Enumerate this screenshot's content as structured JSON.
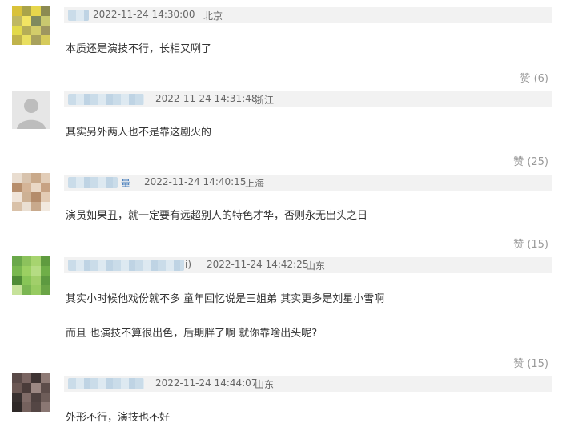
{
  "comments": [
    {
      "time": "2022-11-24 14:30:00",
      "location": "北京",
      "lines": [
        "本质还是演技不行，长相又咧了"
      ],
      "like_label": "赞",
      "like_count": "(6)",
      "name_tail": "",
      "avatar_colors": [
        "#d9c23a",
        "#a9a34a",
        "#e6d64c",
        "#8c8a52",
        "#bfb861",
        "#f2e463",
        "#7f8a5e",
        "#c9c86f",
        "#e2d94a",
        "#b5ad57",
        "#d3cd6a",
        "#9e9660",
        "#c0b34b",
        "#e9df60",
        "#a8a15c",
        "#d6cb5b"
      ]
    },
    {
      "time": "2022-11-24 14:31:48",
      "location": "浙江",
      "lines": [
        "其实另外两人也不是靠这剧火的"
      ],
      "like_label": "赞",
      "like_count": "(25)",
      "name_tail": "",
      "avatar_colors": []
    },
    {
      "time": "2022-11-24 14:40:15",
      "location": "上海",
      "lines": [
        "演员如果丑，就一定要有远超别人的特色才华，否则永无出头之日"
      ],
      "like_label": "赞",
      "like_count": "(15)",
      "name_tail": "量",
      "avatar_colors": [
        "#e9ddd0",
        "#d8c3ad",
        "#c9a98a",
        "#e2cdb8",
        "#b78e6c",
        "#d4b497",
        "#ead8c6",
        "#c7a283",
        "#f0e4d8",
        "#cdb194",
        "#b48c6b",
        "#e3cbb4",
        "#d9c1a8",
        "#eadfd2",
        "#c8a98c",
        "#f2e9df"
      ]
    },
    {
      "time": "2022-11-24 14:42:25",
      "location": "山东",
      "lines": [
        "其实小时候他戏份就不多 童年回忆说是三姐弟 其实更多是刘星小雪啊",
        "而且 也演技不算很出色，后期胖了啊 就你靠啥出头呢?"
      ],
      "like_label": "赞",
      "like_count": "(15)",
      "name_tail": "i)",
      "avatar_colors": [
        "#6aa84a",
        "#8cc25c",
        "#a7d46f",
        "#5f9b3f",
        "#79b84f",
        "#9bd062",
        "#b5dc83",
        "#6fae48",
        "#4f8c36",
        "#88c557",
        "#a1cf6a",
        "#5d9a40",
        "#c6e29a",
        "#7bb652",
        "#97cb61",
        "#6aa446"
      ]
    },
    {
      "time": "2022-11-24 14:44:07",
      "location": "山东",
      "lines": [
        "外形不行，演技也不好"
      ],
      "like_label": "",
      "like_count": "",
      "name_tail": "",
      "avatar_colors": [
        "#5a4a48",
        "#7a6562",
        "#3f3433",
        "#8e7a75",
        "#6b5854",
        "#4a3c3a",
        "#9c8883",
        "#5d4d4a",
        "#37302f",
        "#806c68",
        "#4e413f",
        "#6e5d59",
        "#2f2928",
        "#75625e",
        "#544644",
        "#8a7773"
      ]
    }
  ]
}
